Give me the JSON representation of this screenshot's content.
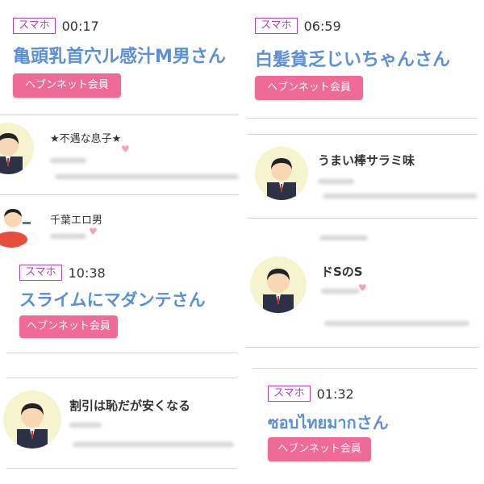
{
  "cards": [
    {
      "tag": "スマホ",
      "time": "00:17",
      "name": "亀頭乳首穴ル感汁M男さん",
      "button": "ヘブンネット会員"
    },
    {
      "tag": "スマホ",
      "time": "06:59",
      "name": "白髪貧乏じいちゃんさん",
      "button": "ヘブンネット会員"
    },
    {
      "tag": "スマホ",
      "time": "10:38",
      "name": "スライムにマダンテさん",
      "button": "ヘブンネット会員"
    },
    {
      "tag": "スマホ",
      "time": "01:32",
      "name": "ซอบไทยมากさん",
      "button": "ヘブンネット会員"
    }
  ],
  "comments": [
    {
      "title": "★不遇な息子★"
    },
    {
      "title": "千葉エロ男"
    },
    {
      "title": "うまい棒サラミ味"
    },
    {
      "title": "ドSのS"
    },
    {
      "title": "割引は恥だが安くなる"
    }
  ],
  "colors": {
    "tag_border": "#b23ec6",
    "name": "#5b8fd6",
    "button": "#f06a97",
    "avatar_bg": "#f6f3cf"
  }
}
